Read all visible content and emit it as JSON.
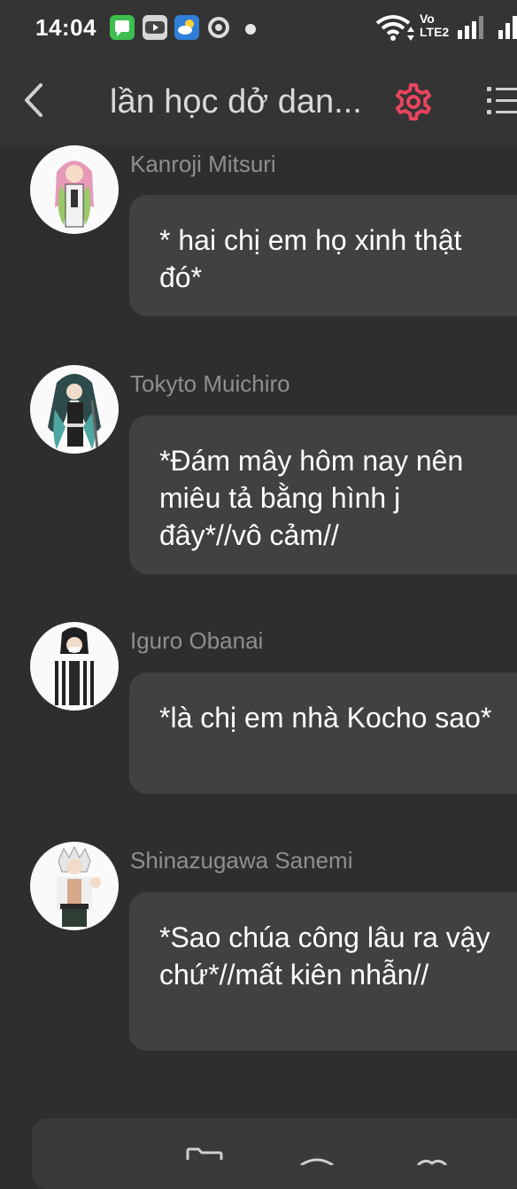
{
  "status_bar": {
    "time": "14:04",
    "network_label_top": "Vo",
    "network_label_bottom": "LTE2"
  },
  "header": {
    "title": "lần học dở dan..."
  },
  "messages": [
    {
      "sender": "Kanroji Mitsuri",
      "text": "* hai chị em họ xinh thật đó*"
    },
    {
      "sender": "Tokyto Muichiro",
      "text": "*Đám mây hôm nay nên miêu tả bằng hình j đây*//vô cảm//"
    },
    {
      "sender": "Iguro Obanai",
      "text": "*là chị em nhà Kocho sao*"
    },
    {
      "sender": "Shinazugawa  Sanemi",
      "text": "*Sao chúa công lâu ra vậy chứ*//mất kiên nhẫn//"
    }
  ],
  "colors": {
    "background": "#2e2e2e",
    "header": "#343434",
    "bubble": "#414141",
    "accent_settings": "#e8455f",
    "sender_name": "#8f8f8f"
  },
  "icons": [
    "message-app-icon",
    "youtube-icon",
    "weather-icon",
    "chrome-icon",
    "wifi-icon",
    "signal-icon",
    "back-arrow-icon",
    "gear-icon",
    "menu-list-icon",
    "folder-icon"
  ]
}
